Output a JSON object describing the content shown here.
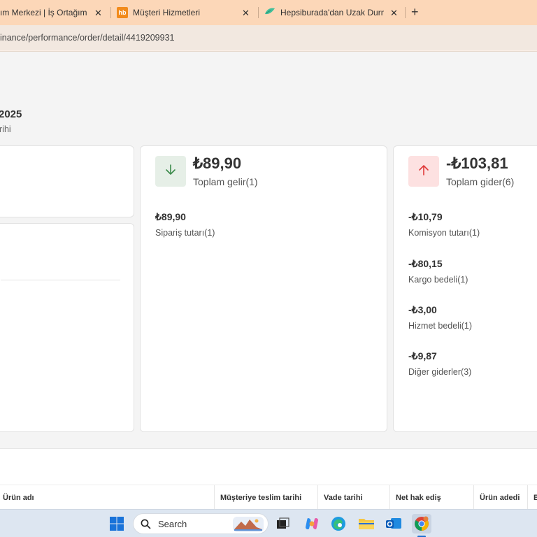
{
  "tabs": [
    {
      "title": "ım Merkezi | İş Ortağım",
      "close": "✕"
    },
    {
      "title": "Müşteri Hizmetleri",
      "favicon_text": "hb",
      "close": "✕"
    },
    {
      "title": "Hepsiburada'dan Uzak Durmak",
      "close": "✕"
    }
  ],
  "new_tab": "+",
  "address": {
    "url": "inance/performance/order/detail/4419209931"
  },
  "page": {
    "title": "2025",
    "subtitle": "rihi"
  },
  "income": {
    "total": "₺89,90",
    "label": "Toplam gelir(1)",
    "items": [
      {
        "amount": "₺89,90",
        "label": "Sipariş tutarı(1)"
      }
    ]
  },
  "expense": {
    "total": "-₺103,81",
    "label": "Toplam gider(6)",
    "items": [
      {
        "amount": "-₺10,79",
        "label": "Komisyon tutarı(1)"
      },
      {
        "amount": "-₺80,15",
        "label": "Kargo bedeli(1)"
      },
      {
        "amount": "-₺3,00",
        "label": "Hizmet bedeli(1)"
      },
      {
        "amount": "-₺9,87",
        "label": "Diğer giderler(3)"
      }
    ]
  },
  "table": {
    "columns": [
      "Ürün adı",
      "Müşteriye teslim tarihi",
      "Vade tarihi",
      "Net hak ediş",
      "Ürün adedi",
      "B"
    ]
  },
  "taskbar": {
    "search_placeholder": "Search"
  },
  "colors": {
    "tabbar": "#fcd7b8",
    "income_icon_bg": "#e6efe7",
    "income_arrow": "#3b8a4a",
    "expense_icon_bg": "#fde1e1",
    "expense_arrow": "#e03a3a"
  }
}
